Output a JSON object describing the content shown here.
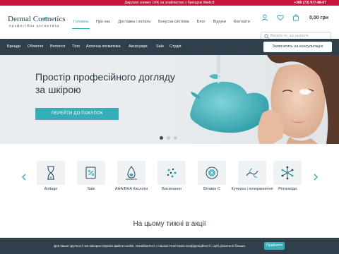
{
  "promo": {
    "text": "Даруємо знижку 10% на знайомство з брендом Medic8",
    "phone": "+380 (73) 977-88-07",
    "bg_color": "#c8133a"
  },
  "header": {
    "logo": {
      "main": "Dermal Cosmetics",
      "sub": "професійна косметика"
    },
    "nav": [
      {
        "label": "Головна",
        "active": true
      },
      {
        "label": "Про нас"
      },
      {
        "label": "Доставка і оплата"
      },
      {
        "label": "Бонусна система"
      },
      {
        "label": "Блог"
      },
      {
        "label": "Відгуки"
      },
      {
        "label": "Контакти"
      }
    ],
    "icons": [
      "user-icon",
      "heart-icon",
      "cart-icon"
    ],
    "cart_total": "0,00 грн",
    "search": {
      "placeholder": "Введіть те, що шукаєте",
      "value": ""
    }
  },
  "category_bar": {
    "items": [
      "Бренди",
      "Обличчя",
      "Волосся",
      "Тіло",
      "Аптечна косметика",
      "Аксесуари",
      "Sale",
      "Студія"
    ],
    "consult_button": "Записатись на консультацію",
    "bg_color": "#2f3f4c"
  },
  "hero": {
    "title": "Простір професійного догляду за шкірою",
    "button": "ПЕРЕЙТИ ДО ПОКУПОК",
    "accent_color": "#35aeb8",
    "slides": 3,
    "active_slide": 1
  },
  "categories": {
    "items": [
      {
        "label": "Antiage",
        "icon": "hourglass-icon"
      },
      {
        "label": "Sale",
        "icon": "sale-tag-icon"
      },
      {
        "label": "AHA/BHA Кислоти",
        "icon": "drop-icon"
      },
      {
        "label": "Висипання",
        "icon": "dots-icon"
      },
      {
        "label": "Вітамін С",
        "icon": "vitamin-c-icon"
      },
      {
        "label": "Купероз і почервоніння",
        "icon": "capillaries-icon"
      },
      {
        "label": "Ретиноїди",
        "icon": "molecule-icon"
      }
    ]
  },
  "weekly": {
    "title": "На цьому тижні в акції"
  },
  "cookie": {
    "text": "Для вашої зручності ми використовуємо файли cookie. Ознайомтеся з нашою Політикою конфіденційності, щоб дізнатися більше.",
    "button": "Прийняти"
  }
}
